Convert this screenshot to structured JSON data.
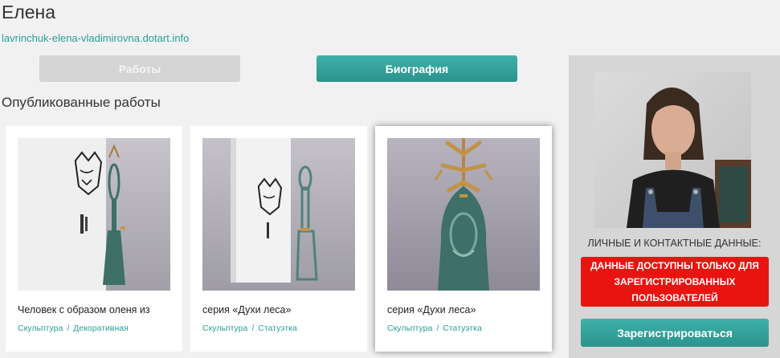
{
  "artist": {
    "name": "Елена",
    "site": "lavrinchuk-elena-vladimirovna.dotart.info"
  },
  "tabs": [
    {
      "label": "Работы",
      "active": false
    },
    {
      "label": "Биография",
      "active": true
    }
  ],
  "section_title": "Опубликованные работы",
  "works": [
    {
      "title": "Человек с образом оленя из",
      "categories": [
        "Скульптура",
        "Декоративная"
      ]
    },
    {
      "title": "серия «Духи леса»",
      "categories": [
        "Скульптура",
        "Статуэтка"
      ]
    },
    {
      "title": "серия «Духи леса»",
      "categories": [
        "Скульптура",
        "Статуэтка"
      ]
    }
  ],
  "category_separator": "/",
  "sidebar": {
    "contacts_label": "ЛИЧНЫЕ И КОНТАКТНЫЕ ДАННЫЕ:",
    "notice": "ДАННЫЕ ДОСТУПНЫ ТОЛЬКО ДЛЯ ЗАРЕГИСТРИРОВАННЫХ ПОЛЬЗОВАТЕЛЕЙ",
    "register_label": "Зарегистрироваться"
  },
  "colors": {
    "accent": "#2a9d96",
    "notice_bg": "#e8140f",
    "inactive_tab": "#d4d4d4"
  }
}
